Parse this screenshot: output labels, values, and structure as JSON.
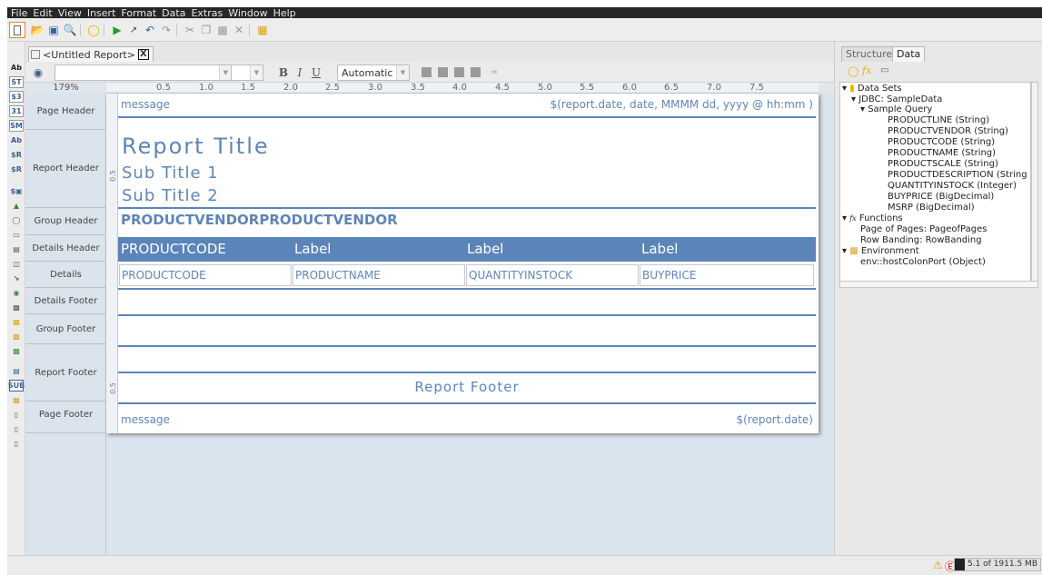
{
  "menubar": [
    "File",
    "Edit",
    "View",
    "Insert",
    "Format",
    "Data",
    "Extras",
    "Window",
    "Help"
  ],
  "document_tab": {
    "label": "<Untitled Report>",
    "close": "X"
  },
  "format_bar": {
    "font_size_value": "",
    "bold": "B",
    "italic": "I",
    "underline": "U",
    "color_value": "Automatic"
  },
  "zoom": "179%",
  "ruler": [
    "0.5",
    "1.0",
    "1.5",
    "2.0",
    "2.5",
    "3.0",
    "3.5",
    "4.0",
    "4.5",
    "5.0",
    "5.5",
    "6.0",
    "6.5",
    "7.0",
    "7.5"
  ],
  "vertical_ruler_marks": {
    "report_header": "0.5",
    "report_footer": "0.5"
  },
  "bands": {
    "page_header": "Page Header",
    "report_header": "Report Header",
    "group_header": "Group Header",
    "details_header": "Details Header",
    "details": "Details",
    "details_footer": "Details Footer",
    "group_footer": "Group Footer",
    "report_footer": "Report Footer",
    "page_footer": "Page Footer"
  },
  "elements": {
    "page_header_message": "message",
    "page_header_date": "$(report.date, date, MMMM dd, yyyy @ hh:mm )",
    "report_title": "Report Title",
    "subtitle1": "Sub Title 1",
    "subtitle2": "Sub Title 2",
    "group_header_field": "PRODUCTVENDORPRODUCTVENDOR",
    "details_header": [
      "PRODUCTCODE",
      "Label",
      "Label",
      "Label"
    ],
    "details": [
      "PRODUCTCODE",
      "PRODUCTNAME",
      "QUANTITYINSTOCK",
      "BUYPRICE"
    ],
    "report_footer": "Report Footer",
    "page_footer_message": "message",
    "page_footer_date": "$(report.date)"
  },
  "right_panel": {
    "tabs": [
      "Structure",
      "Data"
    ],
    "active_tab": "Data",
    "tree": {
      "data_sets": "Data Sets",
      "jdbc": "JDBC: SampleData",
      "query": "Sample Query",
      "fields": [
        "PRODUCTLINE (String)",
        "PRODUCTVENDOR (String)",
        "PRODUCTCODE (String)",
        "PRODUCTNAME (String)",
        "PRODUCTSCALE (String)",
        "PRODUCTDESCRIPTION (String",
        "QUANTITYINSTOCK (Integer)",
        "BUYPRICE (BigDecimal)",
        "MSRP (BigDecimal)"
      ],
      "functions": "Functions",
      "function_items": [
        "Page of Pages: PageofPages",
        "Row Banding: RowBanding"
      ],
      "environment": "Environment",
      "env_items": [
        "env::hostColonPort (Object)"
      ]
    }
  },
  "status": {
    "memory": "5.1 of 1911.5 MB",
    "memory_used_fraction": 0.003
  },
  "colors": {
    "accent": "#5b84b9",
    "element_text": "#5f85b6",
    "details_header_bg": "#5b84b9"
  }
}
